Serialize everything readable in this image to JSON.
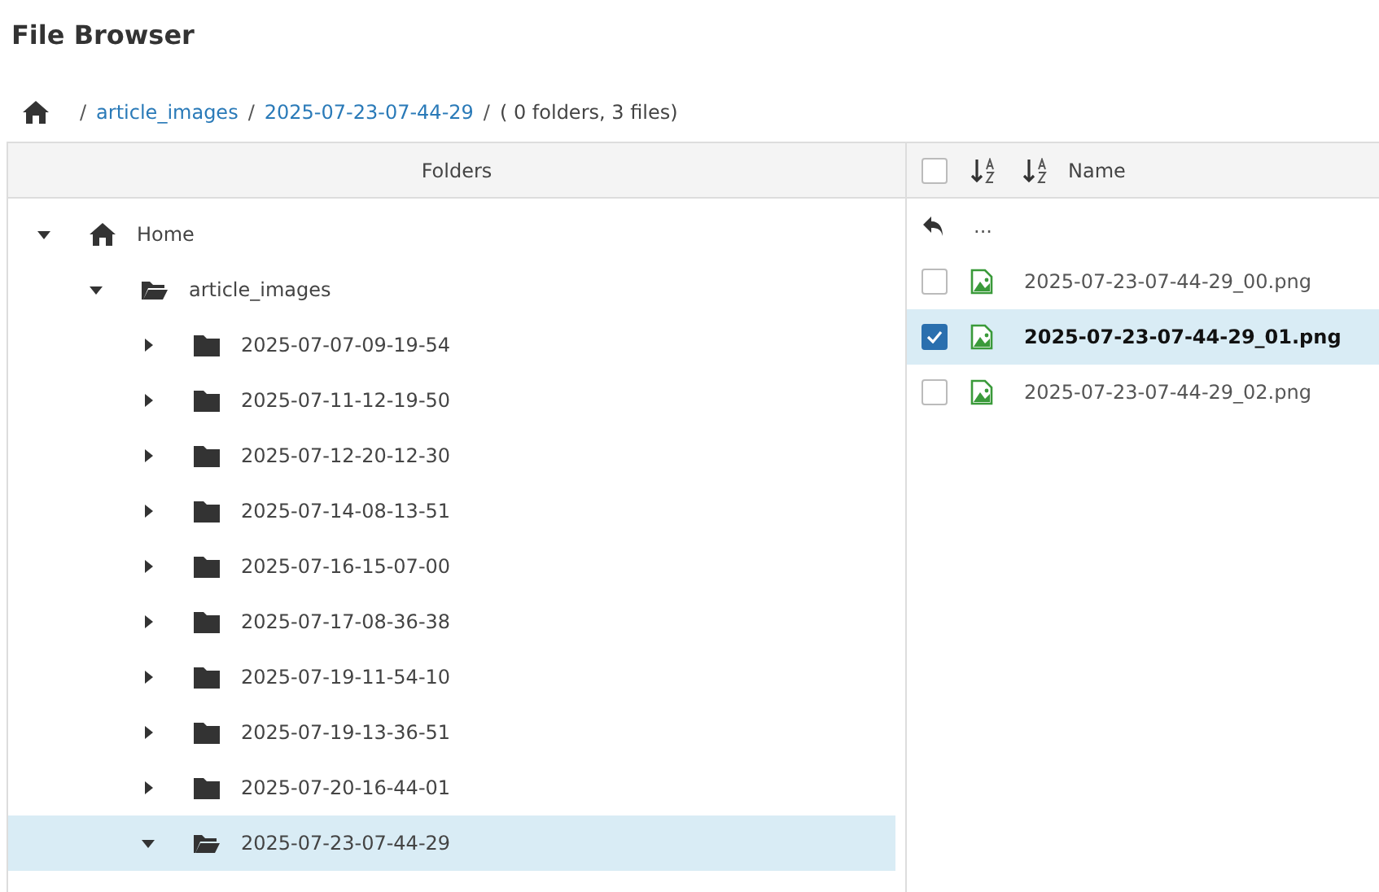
{
  "title": "File Browser",
  "breadcrumb": [
    {
      "kind": "separator",
      "text": "/"
    },
    {
      "kind": "link",
      "text": "article_images"
    },
    {
      "kind": "separator",
      "text": "/"
    },
    {
      "kind": "link",
      "text": "2025-07-23-07-44-29"
    },
    {
      "kind": "separator",
      "text": "/"
    },
    {
      "kind": "summary",
      "text": "( 0 folders, 3 files)"
    }
  ],
  "folders": {
    "heading": "Folders",
    "tree": [
      {
        "label": "Home",
        "kind": "home",
        "expanded": true,
        "selected": false,
        "children": [
          {
            "label": "article_images",
            "kind": "folder",
            "expanded": true,
            "selected": false,
            "children": [
              {
                "label": "2025-07-07-09-19-54",
                "kind": "folder",
                "expanded": false,
                "selected": false
              },
              {
                "label": "2025-07-11-12-19-50",
                "kind": "folder",
                "expanded": false,
                "selected": false
              },
              {
                "label": "2025-07-12-20-12-30",
                "kind": "folder",
                "expanded": false,
                "selected": false
              },
              {
                "label": "2025-07-14-08-13-51",
                "kind": "folder",
                "expanded": false,
                "selected": false
              },
              {
                "label": "2025-07-16-15-07-00",
                "kind": "folder",
                "expanded": false,
                "selected": false
              },
              {
                "label": "2025-07-17-08-36-38",
                "kind": "folder",
                "expanded": false,
                "selected": false
              },
              {
                "label": "2025-07-19-11-54-10",
                "kind": "folder",
                "expanded": false,
                "selected": false
              },
              {
                "label": "2025-07-19-13-36-51",
                "kind": "folder",
                "expanded": false,
                "selected": false
              },
              {
                "label": "2025-07-20-16-44-01",
                "kind": "folder",
                "expanded": false,
                "selected": false
              },
              {
                "label": "2025-07-23-07-44-29",
                "kind": "folder",
                "expanded": true,
                "selected": true
              }
            ]
          }
        ]
      }
    ]
  },
  "files": {
    "all_checked": false,
    "column": "Name",
    "up": "...",
    "rows": [
      {
        "name": "2025-07-23-07-44-29_00.png",
        "checked": false,
        "selected": false
      },
      {
        "name": "2025-07-23-07-44-29_01.png",
        "checked": true,
        "selected": true
      },
      {
        "name": "2025-07-23-07-44-29_02.png",
        "checked": false,
        "selected": false
      }
    ]
  }
}
